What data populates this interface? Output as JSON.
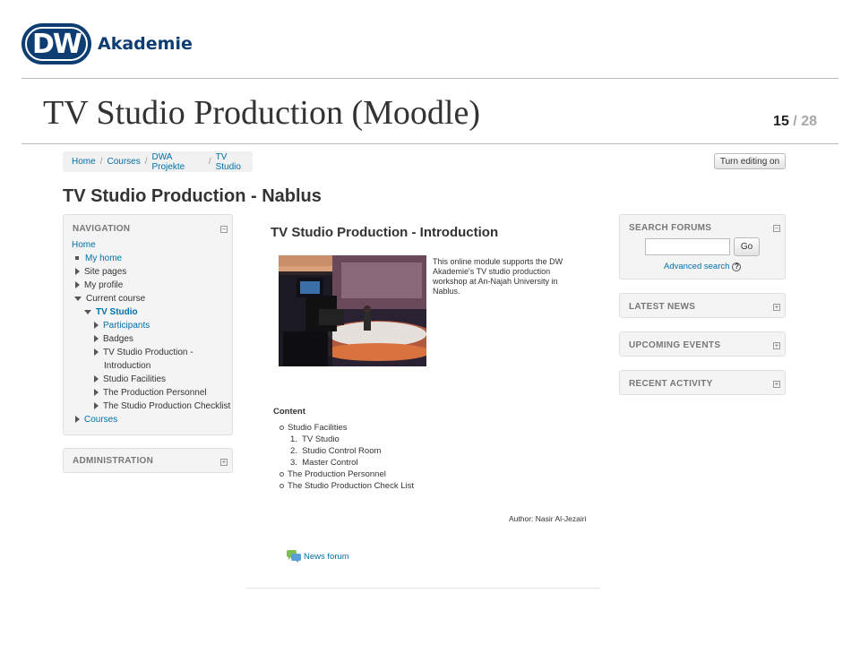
{
  "slide": {
    "logo_mark": "DW",
    "logo_text": "Akademie",
    "title": "TV Studio Production (Moodle)",
    "page_current": "15",
    "page_separator": "/",
    "page_total": "28"
  },
  "breadcrumb": [
    "Home",
    "Courses",
    "DWA Projekte",
    "TV Studio"
  ],
  "breadcrumb_divider": "/",
  "edit_button": "Turn editing on",
  "course_title": "TV Studio Production - Nablus",
  "navigation": {
    "heading": "NAVIGATION",
    "items": {
      "home": "Home",
      "my_home": "My home",
      "site_pages": "Site pages",
      "my_profile": "My profile",
      "current_course": "Current course",
      "tv_studio": "TV Studio",
      "participants": "Participants",
      "badges": "Badges",
      "intro_line1": "TV Studio Production -",
      "intro_line2": "Introduction",
      "studio_facilities": "Studio Facilities",
      "production_personnel": "The Production Personnel",
      "production_checklist": "The Studio Production Checklist",
      "courses": "Courses"
    }
  },
  "administration": {
    "heading": "ADMINISTRATION"
  },
  "search_forums": {
    "heading": "SEARCH FORUMS",
    "input_value": "",
    "go_label": "Go",
    "advanced": "Advanced search",
    "help_glyph": "?"
  },
  "side_blocks": {
    "latest_news": "LATEST NEWS",
    "upcoming_events": "UPCOMING EVENTS",
    "recent_activity": "RECENT ACTIVITY"
  },
  "main": {
    "title": "TV Studio Production - Introduction",
    "intro_text": "This online module supports the DW Akademie's TV studio production workshop at An-Najah University in Nablus.",
    "content_heading": "Content",
    "content_items": {
      "studio_facilities": "Studio Facilities",
      "tv_studio": "TV Studio",
      "control_room": "Studio Control Room",
      "master_control": "Master Control",
      "personnel": "The Production Personnel",
      "checklist": "The Studio Production Check List"
    },
    "numbers": [
      "1.",
      "2.",
      "3."
    ],
    "author": "Author: Nasir Al-Jezairi",
    "news_forum": "News forum"
  },
  "colors": {
    "brand": "#0d3d73",
    "link": "#0070a8",
    "block_bg": "#f4f4f4"
  },
  "icons": [
    "collapse-icon",
    "expand-icon",
    "help-icon",
    "forum-icon"
  ]
}
